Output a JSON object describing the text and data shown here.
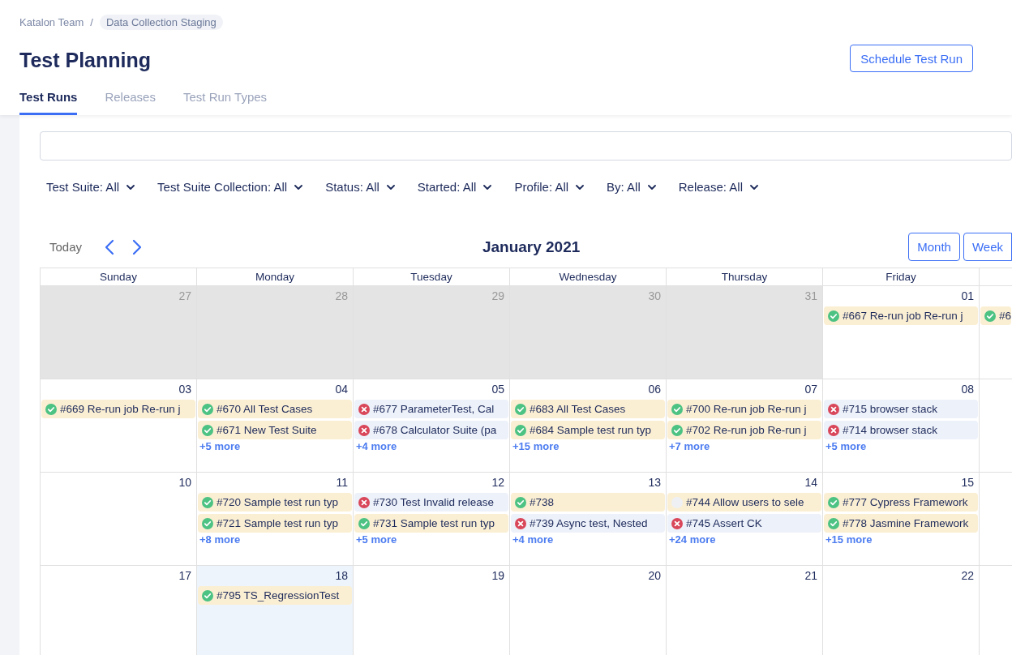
{
  "breadcrumb": {
    "team": "Katalon Team",
    "separator": "/",
    "project": "Data Collection Staging"
  },
  "title": "Test Planning",
  "schedule_button": "Schedule Test Run",
  "tabs": [
    {
      "label": "Test Runs",
      "selected": true
    },
    {
      "label": "Releases",
      "selected": false
    },
    {
      "label": "Test Run Types",
      "selected": false
    }
  ],
  "filters": [
    "Test Suite: All",
    "Test Suite Collection: All",
    "Status: All",
    "Started: All",
    "Profile: All",
    "By: All",
    "Release: All"
  ],
  "calendar": {
    "today_button": "Today",
    "month_title": "January 2021",
    "view_buttons": [
      "Month",
      "Week"
    ],
    "weekdays": [
      "Sunday",
      "Monday",
      "Tuesday",
      "Wednesday",
      "Thursday",
      "Friday"
    ],
    "weeks": [
      [
        {
          "date": "27",
          "other_month": true,
          "today": false
        },
        {
          "date": "28",
          "other_month": true,
          "today": false
        },
        {
          "date": "29",
          "other_month": true,
          "today": false
        },
        {
          "date": "30",
          "other_month": true,
          "today": false
        },
        {
          "date": "31",
          "other_month": true,
          "today": false
        },
        {
          "date": "01",
          "other_month": false,
          "today": false,
          "events": [
            {
              "kind": "passed",
              "label": "#667 Re-run job Re-run j"
            }
          ]
        },
        {
          "other_month": false,
          "today": false,
          "events": [
            {
              "kind": "passed",
              "label": "#6"
            }
          ]
        }
      ],
      [
        {
          "date": "03",
          "other_month": false,
          "today": false,
          "events": [
            {
              "kind": "passed",
              "label": "#669 Re-run job Re-run j"
            }
          ]
        },
        {
          "date": "04",
          "other_month": false,
          "today": false,
          "events": [
            {
              "kind": "passed",
              "label": "#670 All Test Cases"
            },
            {
              "kind": "passed",
              "label": "#671 New Test Suite"
            }
          ],
          "more": "+5 more"
        },
        {
          "date": "05",
          "other_month": false,
          "today": false,
          "events": [
            {
              "kind": "failed",
              "label": "#677 ParameterTest, Cal"
            },
            {
              "kind": "failed",
              "label": "#678 Calculator Suite (pa"
            }
          ],
          "more": "+4 more"
        },
        {
          "date": "06",
          "other_month": false,
          "today": false,
          "events": [
            {
              "kind": "passed",
              "label": "#683 All Test Cases"
            },
            {
              "kind": "passed",
              "label": "#684 Sample test run typ"
            }
          ],
          "more": "+15 more"
        },
        {
          "date": "07",
          "other_month": false,
          "today": false,
          "events": [
            {
              "kind": "passed",
              "label": "#700 Re-run job Re-run j"
            },
            {
              "kind": "passed",
              "label": "#702 Re-run job Re-run j"
            }
          ],
          "more": "+7 more"
        },
        {
          "date": "08",
          "other_month": false,
          "today": false,
          "events": [
            {
              "kind": "failed",
              "label": "#715 browser stack"
            },
            {
              "kind": "failed",
              "label": "#714 browser stack"
            }
          ],
          "more": "+5 more"
        }
      ],
      [
        {
          "date": "10",
          "other_month": false,
          "today": false
        },
        {
          "date": "11",
          "other_month": false,
          "today": false,
          "events": [
            {
              "kind": "passed",
              "label": "#720 Sample test run typ"
            },
            {
              "kind": "passed",
              "label": "#721 Sample test run typ"
            }
          ],
          "more": "+8 more"
        },
        {
          "date": "12",
          "other_month": false,
          "today": false,
          "events": [
            {
              "kind": "failed",
              "label": "#730 Test Invalid release"
            },
            {
              "kind": "passed",
              "label": "#731 Sample test run typ"
            }
          ],
          "more": "+5 more"
        },
        {
          "date": "13",
          "other_month": false,
          "today": false,
          "events": [
            {
              "kind": "passed",
              "label": "#738"
            },
            {
              "kind": "failed",
              "label": "#739 Async test, Nested"
            }
          ],
          "more": "+4 more"
        },
        {
          "date": "14",
          "other_month": false,
          "today": false,
          "events": [
            {
              "kind": "pending",
              "label": "#744 Allow users to sele"
            },
            {
              "kind": "failed",
              "label": "#745 Assert CK"
            }
          ],
          "more": "+24 more"
        },
        {
          "date": "15",
          "other_month": false,
          "today": false,
          "events": [
            {
              "kind": "passed",
              "label": "#777 Cypress Framework"
            },
            {
              "kind": "passed",
              "label": "#778 Jasmine Framework"
            }
          ],
          "more": "+15 more"
        }
      ],
      [
        {
          "date": "17",
          "other_month": false,
          "today": false
        },
        {
          "date": "18",
          "other_month": false,
          "today": true,
          "events": [
            {
              "kind": "passed",
              "label": "#795 TS_RegressionTest"
            }
          ]
        },
        {
          "date": "19",
          "other_month": false,
          "today": false
        },
        {
          "date": "20",
          "other_month": false,
          "today": false
        },
        {
          "date": "21",
          "other_month": false,
          "today": false
        },
        {
          "date": "22",
          "other_month": false,
          "today": false
        }
      ]
    ]
  }
}
